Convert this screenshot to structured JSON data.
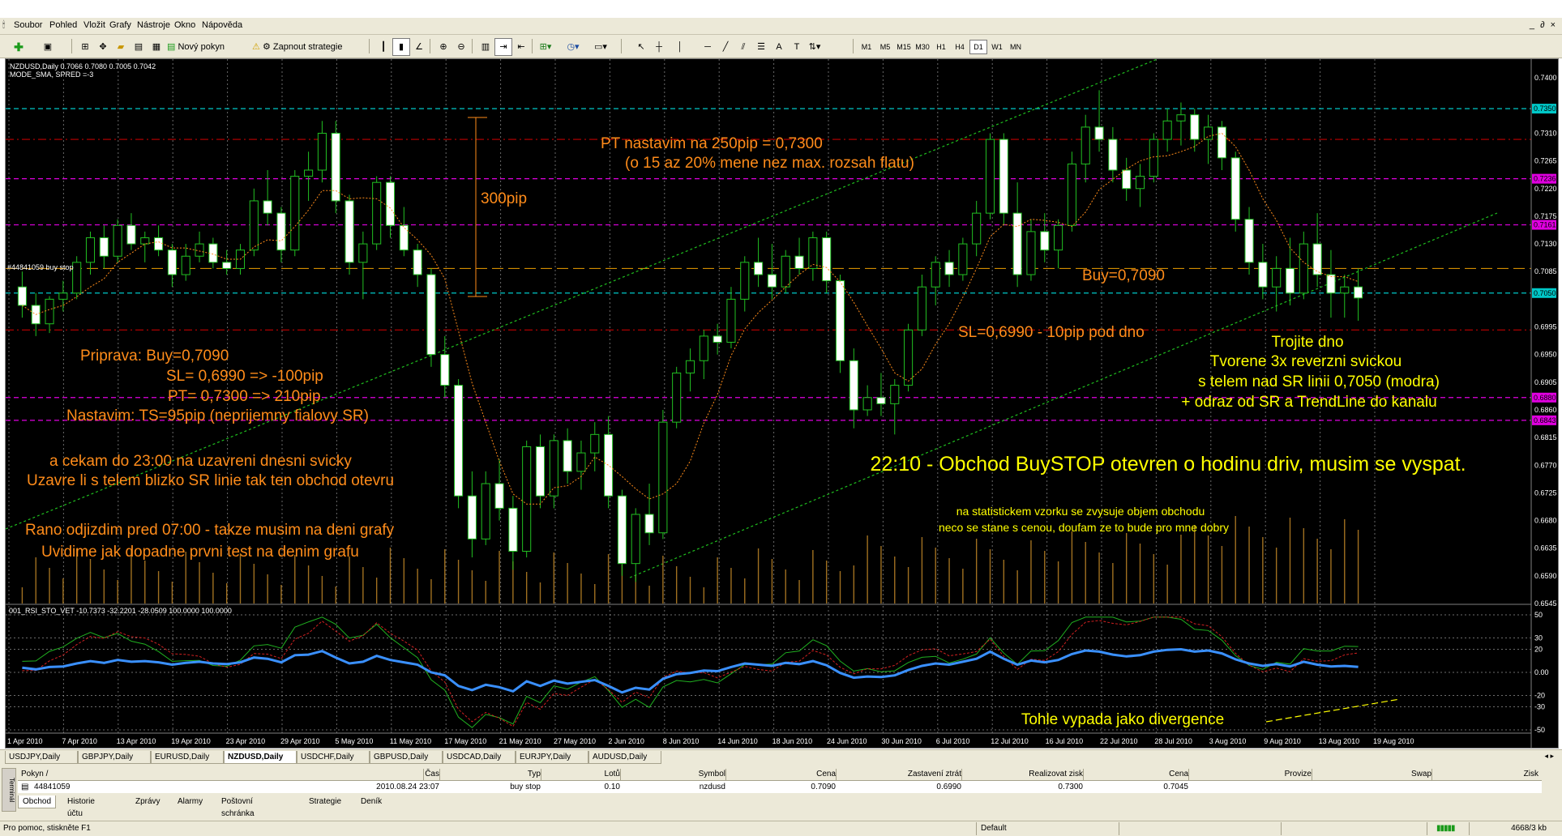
{
  "menu": {
    "items": [
      "Soubor",
      "Pohled",
      "Vložit",
      "Grafy",
      "Nástroje",
      "Okno",
      "Nápověda"
    ],
    "window_controls": "_ ∂ ×"
  },
  "toolbar": {
    "new_order": "Nový pokyn",
    "start_strategy": "Zapnout strategie",
    "text_tool": "A",
    "timeframes": [
      "M1",
      "M5",
      "M15",
      "M30",
      "H1",
      "H4",
      "D1",
      "W1",
      "MN"
    ],
    "selected_timeframe": "D1"
  },
  "chart": {
    "header_line1": "NZDUSD,Daily  0.7066 0.7080 0.7005 0.7042",
    "header_line2": "MODE_SMA, SPRED =-3",
    "order_marker": "#44841059 buy stop",
    "indicator_label": "001_RSI_STO_VET -10.7373 -32.2201 -28.0509 100.0000 100.0000",
    "price_labels": [
      "0.7400",
      "0.7310",
      "0.7265",
      "0.7220",
      "0.7175",
      "0.7130",
      "0.7085",
      "0.6995",
      "0.6950",
      "0.6905",
      "0.6860",
      "0.6815",
      "0.6770",
      "0.6725",
      "0.6680",
      "0.6635",
      "0.6590",
      "0.6545"
    ],
    "price_markers": [
      {
        "text": "0.7350",
        "color": "#00c8c8"
      },
      {
        "text": "0.7236",
        "color": "#e000e0"
      },
      {
        "text": "0.7161",
        "color": "#e000e0"
      },
      {
        "text": "0.7050",
        "color": "#00c8c8"
      },
      {
        "text": "0.6880",
        "color": "#e000e0"
      },
      {
        "text": "0.6843",
        "color": "#e000e0"
      }
    ],
    "osc_labels": [
      "50",
      "30",
      "20",
      "0.00",
      "-20",
      "-30",
      "-50"
    ],
    "date_labels": [
      "1 Apr 2010",
      "7 Apr 2010",
      "13 Apr 2010",
      "19 Apr 2010",
      "23 Apr 2010",
      "29 Apr 2010",
      "5 May 2010",
      "11 May 2010",
      "17 May 2010",
      "21 May 2010",
      "27 May 2010",
      "2 Jun 2010",
      "8 Jun 2010",
      "14 Jun 2010",
      "18 Jun 2010",
      "24 Jun 2010",
      "30 Jun 2010",
      "6 Jul 2010",
      "12 Jul 2010",
      "16 Jul 2010",
      "22 Jul 2010",
      "28 Jul 2010",
      "3 Aug 2010",
      "9 Aug 2010",
      "13 Aug 2010",
      "19 Aug 2010"
    ],
    "annotations": {
      "pt_line1": "PT nastavim na 250pip = 0,7300",
      "pt_line2": "(o 15 az 20% mene nez max. rozsah flatu)",
      "pips300": "300pip",
      "buy": "Buy=0,7090",
      "sl": "SL=0,6990 - 10pip pod dno",
      "triple1": "Trojite dno",
      "triple2": "Tvorene 3x reverzni svickou",
      "triple3": "s telem nad SR linii 0,7050 (modra)",
      "triple4": "+ odraz od SR a TrendLine do kanalu",
      "prep1": "Priprava:  Buy=0,7090",
      "prep2": "SL= 0,6990  => -100pip",
      "prep3": "PT= 0,7300  => 210pip",
      "prep4": "Nastavim:    TS=95pip (neprijemny fialovy SR)",
      "wait1": "a cekam do 23:00 na uzavreni dnesni svicky",
      "wait2": "Uzavre li s telem blizko SR linie tak ten obchod otevru",
      "morning1": "Rano odjizdim pred 07:00 - takze musim na deni grafy",
      "morning2": "Uvidime jak dopadne prvni test na denim grafu",
      "opened": "22:10 - Obchod BuySTOP otevren o hodinu driv, musim se vyspat.",
      "stat1": "na statistickem vzorku se zvysuje objem obchodu",
      "stat2": "neco se stane s cenou, doufam ze to bude pro mne dobry",
      "divergence": "Tohle vypada jako divergence"
    }
  },
  "chart_data": {
    "type": "candlestick",
    "symbol": "NZDUSD",
    "timeframe": "Daily",
    "ylim": [
      0.6545,
      0.742
    ],
    "levels": [
      {
        "value": 0.735,
        "color": "#00c8c8"
      },
      {
        "value": 0.73,
        "color": "#c00000"
      },
      {
        "value": 0.7236,
        "color": "#e000e0"
      },
      {
        "value": 0.7161,
        "color": "#e000e0"
      },
      {
        "value": 0.709,
        "color": "#d28c00"
      },
      {
        "value": 0.705,
        "color": "#00c8c8"
      },
      {
        "value": 0.699,
        "color": "#c00000"
      },
      {
        "value": 0.688,
        "color": "#e000e0"
      },
      {
        "value": 0.6843,
        "color": "#e000e0"
      }
    ],
    "candles": [
      [
        0.706,
        0.7085,
        0.701,
        0.703
      ],
      [
        0.703,
        0.705,
        0.698,
        0.7
      ],
      [
        0.7,
        0.7045,
        0.6985,
        0.704
      ],
      [
        0.704,
        0.707,
        0.702,
        0.705
      ],
      [
        0.705,
        0.711,
        0.704,
        0.71
      ],
      [
        0.71,
        0.715,
        0.708,
        0.714
      ],
      [
        0.714,
        0.716,
        0.709,
        0.711
      ],
      [
        0.711,
        0.717,
        0.71,
        0.716
      ],
      [
        0.716,
        0.718,
        0.712,
        0.713
      ],
      [
        0.713,
        0.715,
        0.71,
        0.714
      ],
      [
        0.714,
        0.716,
        0.711,
        0.712
      ],
      [
        0.712,
        0.713,
        0.706,
        0.708
      ],
      [
        0.708,
        0.713,
        0.707,
        0.711
      ],
      [
        0.711,
        0.715,
        0.71,
        0.713
      ],
      [
        0.713,
        0.714,
        0.709,
        0.71
      ],
      [
        0.71,
        0.712,
        0.708,
        0.709
      ],
      [
        0.709,
        0.713,
        0.708,
        0.712
      ],
      [
        0.712,
        0.722,
        0.711,
        0.72
      ],
      [
        0.72,
        0.725,
        0.716,
        0.718
      ],
      [
        0.718,
        0.719,
        0.71,
        0.712
      ],
      [
        0.712,
        0.725,
        0.711,
        0.724
      ],
      [
        0.724,
        0.728,
        0.72,
        0.725
      ],
      [
        0.725,
        0.733,
        0.723,
        0.731
      ],
      [
        0.731,
        0.733,
        0.718,
        0.72
      ],
      [
        0.72,
        0.721,
        0.708,
        0.71
      ],
      [
        0.71,
        0.715,
        0.704,
        0.713
      ],
      [
        0.713,
        0.724,
        0.712,
        0.723
      ],
      [
        0.723,
        0.724,
        0.714,
        0.716
      ],
      [
        0.716,
        0.719,
        0.711,
        0.712
      ],
      [
        0.712,
        0.713,
        0.706,
        0.708
      ],
      [
        0.708,
        0.709,
        0.693,
        0.695
      ],
      [
        0.695,
        0.698,
        0.688,
        0.69
      ],
      [
        0.69,
        0.691,
        0.67,
        0.672
      ],
      [
        0.672,
        0.676,
        0.662,
        0.665
      ],
      [
        0.665,
        0.676,
        0.664,
        0.674
      ],
      [
        0.674,
        0.678,
        0.668,
        0.67
      ],
      [
        0.67,
        0.672,
        0.66,
        0.663
      ],
      [
        0.663,
        0.681,
        0.662,
        0.68
      ],
      [
        0.68,
        0.682,
        0.67,
        0.672
      ],
      [
        0.672,
        0.682,
        0.67,
        0.681
      ],
      [
        0.681,
        0.683,
        0.674,
        0.676
      ],
      [
        0.676,
        0.681,
        0.673,
        0.679
      ],
      [
        0.679,
        0.684,
        0.676,
        0.682
      ],
      [
        0.682,
        0.685,
        0.67,
        0.672
      ],
      [
        0.672,
        0.673,
        0.659,
        0.661
      ],
      [
        0.661,
        0.67,
        0.658,
        0.669
      ],
      [
        0.669,
        0.674,
        0.664,
        0.666
      ],
      [
        0.666,
        0.686,
        0.665,
        0.684
      ],
      [
        0.684,
        0.693,
        0.683,
        0.692
      ],
      [
        0.692,
        0.696,
        0.689,
        0.694
      ],
      [
        0.694,
        0.699,
        0.691,
        0.698
      ],
      [
        0.698,
        0.7,
        0.695,
        0.697
      ],
      [
        0.697,
        0.706,
        0.696,
        0.704
      ],
      [
        0.704,
        0.711,
        0.702,
        0.71
      ],
      [
        0.71,
        0.714,
        0.706,
        0.708
      ],
      [
        0.708,
        0.713,
        0.704,
        0.706
      ],
      [
        0.706,
        0.712,
        0.705,
        0.711
      ],
      [
        0.711,
        0.714,
        0.708,
        0.709
      ],
      [
        0.709,
        0.715,
        0.707,
        0.714
      ],
      [
        0.714,
        0.715,
        0.705,
        0.707
      ],
      [
        0.707,
        0.708,
        0.692,
        0.694
      ],
      [
        0.694,
        0.696,
        0.683,
        0.686
      ],
      [
        0.686,
        0.69,
        0.685,
        0.688
      ],
      [
        0.688,
        0.692,
        0.685,
        0.687
      ],
      [
        0.687,
        0.691,
        0.682,
        0.69
      ],
      [
        0.69,
        0.7,
        0.689,
        0.699
      ],
      [
        0.699,
        0.708,
        0.698,
        0.706
      ],
      [
        0.706,
        0.711,
        0.703,
        0.71
      ],
      [
        0.71,
        0.712,
        0.706,
        0.708
      ],
      [
        0.708,
        0.714,
        0.707,
        0.713
      ],
      [
        0.713,
        0.72,
        0.711,
        0.718
      ],
      [
        0.718,
        0.731,
        0.717,
        0.73
      ],
      [
        0.73,
        0.731,
        0.716,
        0.718
      ],
      [
        0.718,
        0.723,
        0.706,
        0.708
      ],
      [
        0.708,
        0.717,
        0.707,
        0.715
      ],
      [
        0.715,
        0.718,
        0.71,
        0.712
      ],
      [
        0.712,
        0.717,
        0.709,
        0.716
      ],
      [
        0.716,
        0.728,
        0.715,
        0.726
      ],
      [
        0.726,
        0.734,
        0.723,
        0.732
      ],
      [
        0.732,
        0.738,
        0.728,
        0.73
      ],
      [
        0.73,
        0.732,
        0.723,
        0.725
      ],
      [
        0.725,
        0.727,
        0.72,
        0.722
      ],
      [
        0.722,
        0.726,
        0.719,
        0.724
      ],
      [
        0.724,
        0.731,
        0.723,
        0.73
      ],
      [
        0.73,
        0.735,
        0.728,
        0.733
      ],
      [
        0.733,
        0.736,
        0.729,
        0.734
      ],
      [
        0.734,
        0.735,
        0.728,
        0.73
      ],
      [
        0.73,
        0.734,
        0.726,
        0.732
      ],
      [
        0.732,
        0.733,
        0.725,
        0.727
      ],
      [
        0.727,
        0.728,
        0.715,
        0.717
      ],
      [
        0.717,
        0.719,
        0.708,
        0.71
      ],
      [
        0.71,
        0.713,
        0.704,
        0.706
      ],
      [
        0.706,
        0.711,
        0.702,
        0.709
      ],
      [
        0.709,
        0.714,
        0.703,
        0.705
      ],
      [
        0.705,
        0.715,
        0.704,
        0.713
      ],
      [
        0.713,
        0.718,
        0.706,
        0.708
      ],
      [
        0.708,
        0.712,
        0.701,
        0.705
      ],
      [
        0.705,
        0.708,
        0.701,
        0.706
      ],
      [
        0.706,
        0.709,
        0.7005,
        0.7042
      ]
    ]
  },
  "tabs": {
    "items": [
      "USDJPY,Daily",
      "GBPJPY,Daily",
      "EURUSD,Daily",
      "NZDUSD,Daily",
      "USDCHF,Daily",
      "GBPUSD,Daily",
      "USDCAD,Daily",
      "EURJPY,Daily",
      "AUDUSD,Daily"
    ],
    "active": "NZDUSD,Daily"
  },
  "terminal": {
    "side_label": "Terminál",
    "headers": [
      "Pokyn  /",
      "Čas",
      "Typ",
      "Lotů",
      "Symbol",
      "Cena",
      "Zastavení ztrát",
      "Realizovat zisk",
      "Cena",
      "Provize",
      "Swap",
      "Zisk"
    ],
    "row": [
      "44841059",
      "2010.08.24 23:07",
      "buy stop",
      "0.10",
      "nzdusd",
      "0.7090",
      "0.6990",
      "0.7300",
      "0.7045",
      "",
      ""
    ],
    "tabs": [
      "Obchod",
      "Historie účtu",
      "Zprávy",
      "Alarmy",
      "Poštovní schránka",
      "Strategie",
      "Deník"
    ],
    "active_tab": "Obchod"
  },
  "status": {
    "help": "Pro pomoc, stiskněte F1",
    "profile": "Default",
    "traffic": "4668/3 kb"
  }
}
